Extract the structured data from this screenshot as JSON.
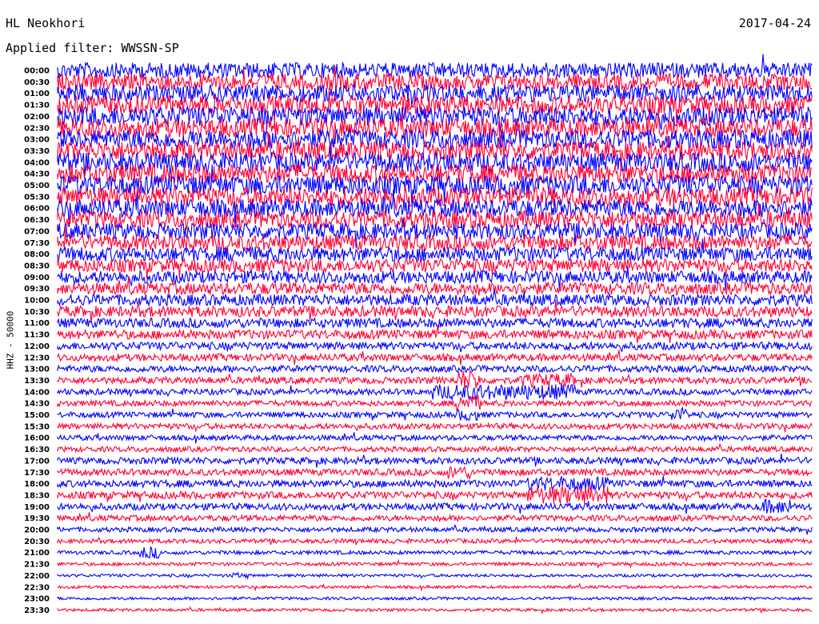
{
  "header": {
    "station": "HL Neokhori",
    "date": "2017-04-24",
    "filter_label": "Applied filter: WWSSN-SP"
  },
  "chart_data": {
    "type": "helicorder",
    "title": "HL Neokhori",
    "date": "2017-04-24",
    "filter": "Applied filter: WWSSN-SP",
    "ylabel": "HHZ - 50000",
    "xlabel": "",
    "row_labels": [
      "00:00",
      "00:30",
      "01:00",
      "01:30",
      "02:00",
      "02:30",
      "03:00",
      "03:30",
      "04:00",
      "04:30",
      "05:00",
      "05:30",
      "06:00",
      "06:30",
      "07:00",
      "07:30",
      "08:00",
      "08:30",
      "09:00",
      "09:30",
      "10:00",
      "10:30",
      "11:00",
      "11:30",
      "12:00",
      "12:30",
      "13:00",
      "13:30",
      "14:00",
      "14:30",
      "15:00",
      "15:30",
      "16:00",
      "16:30",
      "17:00",
      "17:30",
      "18:00",
      "18:30",
      "19:00",
      "19:30",
      "20:00",
      "20:30",
      "21:00",
      "21:30",
      "22:00",
      "22:30",
      "23:00",
      "23:30"
    ],
    "row_minutes": 30,
    "trace_colors": [
      "#0000ff",
      "#ff0033"
    ],
    "relative_amplitude": [
      1.6,
      1.7,
      1.8,
      1.9,
      2.0,
      2.0,
      2.0,
      2.0,
      2.0,
      2.0,
      2.0,
      2.0,
      1.9,
      1.8,
      1.7,
      1.6,
      1.5,
      1.4,
      1.3,
      1.25,
      1.2,
      1.15,
      1.0,
      0.95,
      0.8,
      0.75,
      0.7,
      0.7,
      0.65,
      0.6,
      0.6,
      0.6,
      0.55,
      0.55,
      0.7,
      0.7,
      0.75,
      0.75,
      0.7,
      0.6,
      0.5,
      0.45,
      0.4,
      0.35,
      0.3,
      0.3,
      0.3,
      0.3
    ],
    "grid": false
  }
}
